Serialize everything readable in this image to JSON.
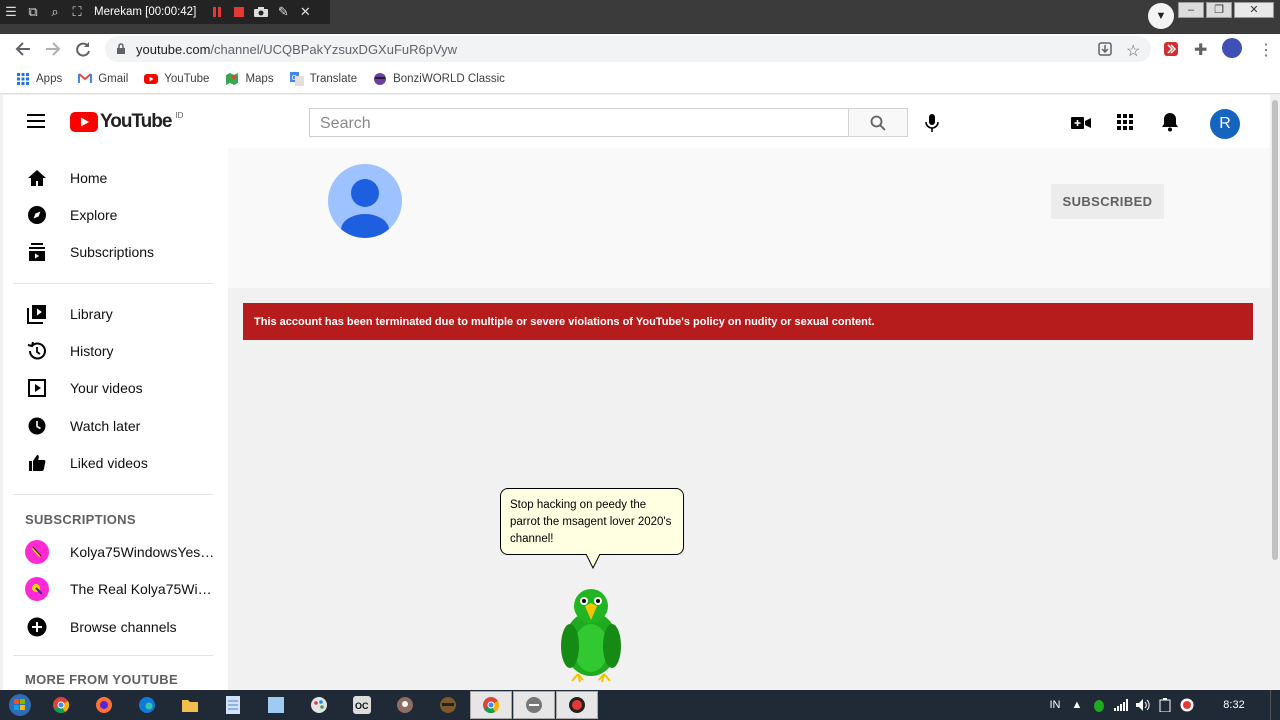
{
  "recorder": {
    "label": "Merekam [00:00:42]"
  },
  "browser": {
    "url_host": "youtube.com",
    "url_path": "/channel/UCQBPakYzsuxDGXuFuR6pVyw",
    "profile_avatar": "icon-avatar"
  },
  "bookmarks": [
    {
      "label": "Apps",
      "icon": "apps-grid-icon"
    },
    {
      "label": "Gmail",
      "icon": "gmail-icon"
    },
    {
      "label": "YouTube",
      "icon": "youtube-icon"
    },
    {
      "label": "Maps",
      "icon": "maps-icon"
    },
    {
      "label": "Translate",
      "icon": "translate-icon"
    },
    {
      "label": "BonziWORLD Classic",
      "icon": "bonzi-icon"
    }
  ],
  "youtube": {
    "logo_text": "YouTube",
    "region": "ID",
    "search_placeholder": "Search",
    "avatar_letter": "R"
  },
  "sidebar": {
    "primary": [
      {
        "label": "Home",
        "icon": "home-icon"
      },
      {
        "label": "Explore",
        "icon": "compass-icon"
      },
      {
        "label": "Subscriptions",
        "icon": "subscriptions-icon"
      }
    ],
    "secondary": [
      {
        "label": "Library",
        "icon": "library-icon"
      },
      {
        "label": "History",
        "icon": "history-icon"
      },
      {
        "label": "Your videos",
        "icon": "your-videos-icon"
      },
      {
        "label": "Watch later",
        "icon": "clock-icon"
      },
      {
        "label": "Liked videos",
        "icon": "thumbs-up-icon"
      }
    ],
    "subscriptions_heading": "SUBSCRIPTIONS",
    "subscriptions": [
      {
        "label": "Kolya75WindowsYes…"
      },
      {
        "label": "The Real Kolya75Wi…"
      }
    ],
    "browse_channels": "Browse channels",
    "more_heading": "MORE FROM YOUTUBE"
  },
  "channel": {
    "subscribe_label": "SUBSCRIBED",
    "termination_notice": "This account has been terminated due to multiple or severe violations of YouTube's policy on nudity or sexual content."
  },
  "agent": {
    "speech": "Stop hacking on peedy the parrot the msagent lover 2020's channel!"
  },
  "taskbar": {
    "language": "IN",
    "time": "8:32"
  },
  "colors": {
    "youtube_red": "#ff0000",
    "alert_red": "#b71c1c",
    "avatar_blue": "#1565c0",
    "channel_avatar": "#9ec2ff"
  }
}
